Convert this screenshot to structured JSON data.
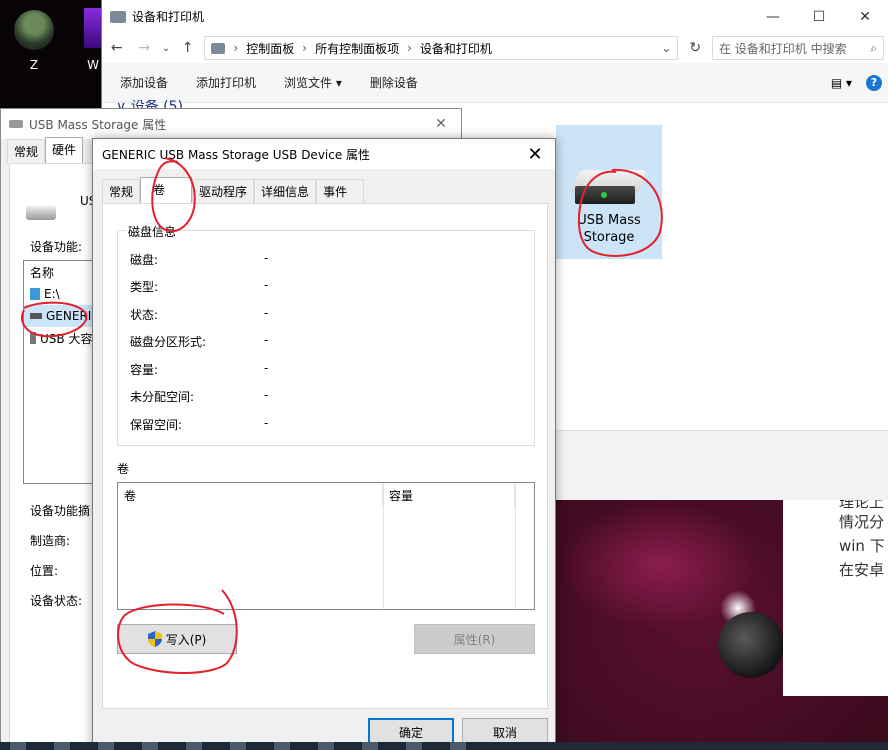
{
  "desktop": {
    "icons": [
      {
        "label": "Z"
      },
      {
        "label": "W"
      }
    ]
  },
  "explorer": {
    "title": "设备和打印机",
    "controls": {
      "minimize": "—",
      "maximize": "☐",
      "close": "✕"
    },
    "nav": {
      "back": "←",
      "forward": "→",
      "recent": "⌄",
      "up": "↑"
    },
    "breadcrumbs": [
      "控制面板",
      "所有控制面板项",
      "设备和打印机"
    ],
    "refresh": "↻",
    "search_placeholder": "在 设备和打印机 中搜索",
    "commands": [
      {
        "label": "添加设备"
      },
      {
        "label": "添加打印机"
      },
      {
        "label": "浏览文件 ▾"
      },
      {
        "label": "删除设备"
      }
    ],
    "view_toggle": "▤ ▾",
    "help": "?",
    "section_header_partial": "∨ 设备 (5)",
    "device": {
      "name": "USB Mass Storage"
    }
  },
  "text_panel": {
    "lines": [
      "理论上",
      "情况分",
      "win 下",
      "在安卓"
    ]
  },
  "back_dialog": {
    "title": "USB Mass Storage 属性",
    "close": "✕",
    "tabs": [
      "常规",
      "硬件"
    ],
    "device_name_partial": "US",
    "functions_label": "设备功能:",
    "list_header": "名称",
    "list_items": [
      {
        "label": "E:\\"
      },
      {
        "label": "GENERIC"
      },
      {
        "label": "USB 大容"
      }
    ],
    "summary_label": "设备功能摘",
    "manufacturer_label": "制造商:",
    "location_label": "位置:",
    "status_label": "设备状态:"
  },
  "dialog": {
    "title": "GENERIC USB Mass Storage USB Device 属性",
    "close": "✕",
    "tabs": [
      {
        "label": "常规",
        "active": false
      },
      {
        "label": "卷",
        "active": true
      },
      {
        "label": "驱动程序",
        "active": false
      },
      {
        "label": "详细信息",
        "active": false
      },
      {
        "label": "事件",
        "active": false
      }
    ],
    "disk_info": {
      "legend": "磁盘信息",
      "rows": [
        {
          "label": "磁盘:",
          "value": "-"
        },
        {
          "label": "类型:",
          "value": "-"
        },
        {
          "label": "状态:",
          "value": "-"
        },
        {
          "label": "磁盘分区形式:",
          "value": "-"
        },
        {
          "label": "容量:",
          "value": "-"
        },
        {
          "label": "未分配空间:",
          "value": "-"
        },
        {
          "label": "保留空间:",
          "value": "-"
        }
      ]
    },
    "volumes": {
      "label": "卷",
      "columns": [
        "卷",
        "容量"
      ]
    },
    "populate_button": "写入(P)",
    "properties_button": "属性(R)",
    "ok_button": "确定",
    "cancel_button": "取消"
  },
  "colors": {
    "annotation": "#e5202c",
    "selection": "#cce4f7",
    "accent": "#0078d7"
  }
}
